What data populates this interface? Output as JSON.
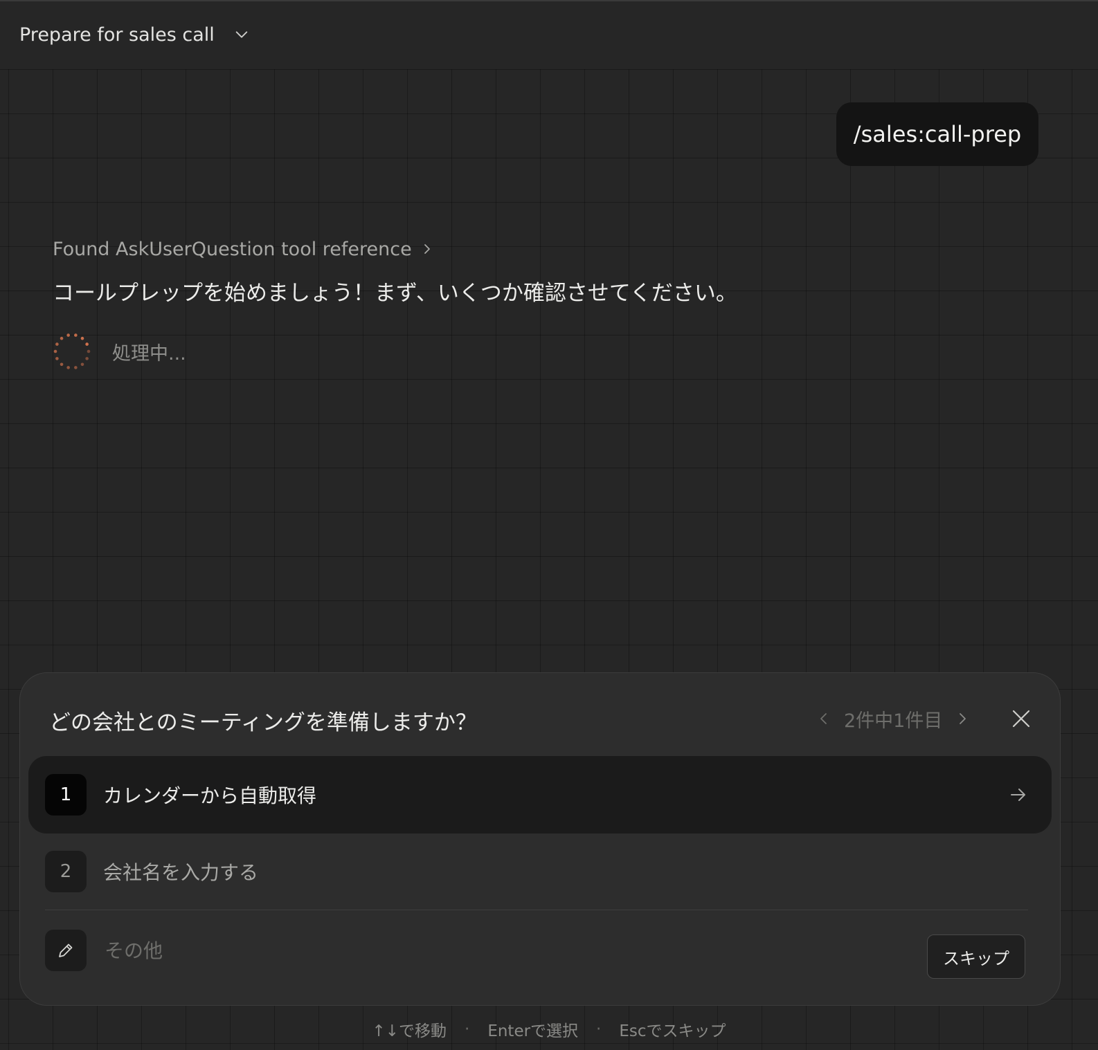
{
  "header": {
    "title": "Prepare for sales call",
    "dropdown_icon": "chevron-down-icon"
  },
  "chat": {
    "user_message": "/sales:call-prep",
    "tool_reference": "Found AskUserQuestion tool reference",
    "assistant_message": "コールプレップを始めましょう！まず、いくつか確認させてください。",
    "processing_label": "処理中...",
    "spinner_color": "#d8764f"
  },
  "question_card": {
    "question": "どの会社とのミーティングを準備しますか？",
    "pager": "2件中1件目",
    "options": [
      {
        "number": "1",
        "label": "カレンダーから自動取得",
        "selected": true
      },
      {
        "number": "2",
        "label": "会社名を入力する",
        "selected": false
      }
    ],
    "other": {
      "placeholder": "その他"
    },
    "skip_label": "スキップ"
  },
  "hints": {
    "move": "↑↓で移動",
    "separator": "·",
    "select": "Enterで選択",
    "skip": "Escでスキップ"
  }
}
